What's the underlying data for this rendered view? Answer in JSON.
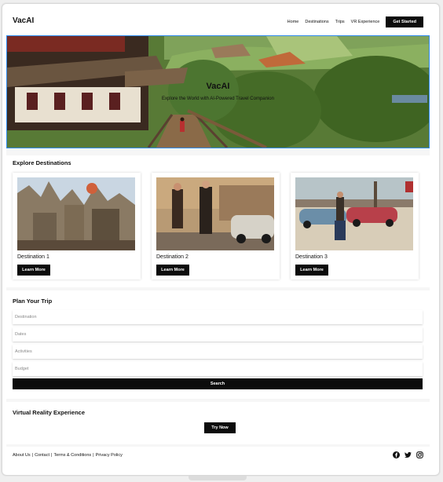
{
  "nav": {
    "brand": "VacAI",
    "links": [
      "Home",
      "Destinations",
      "Trips",
      "VR Experience"
    ],
    "cta": "Get Started"
  },
  "hero": {
    "title": "VacAI",
    "subtitle": "Explore the World with AI-Powered Travel Companion"
  },
  "destinations": {
    "heading": "Explore Destinations",
    "cards": [
      {
        "title": "Destination 1",
        "button": "Learn More",
        "image": "fantasy-city-balloons"
      },
      {
        "title": "Destination 2",
        "button": "Learn More",
        "image": "men-vintage-car-street"
      },
      {
        "title": "Destination 3",
        "button": "Learn More",
        "image": "beach-vintage-cars"
      }
    ]
  },
  "plan": {
    "heading": "Plan Your Trip",
    "fields": [
      {
        "placeholder": "Destination"
      },
      {
        "placeholder": "Dates"
      },
      {
        "placeholder": "Activities"
      },
      {
        "placeholder": "Budget"
      }
    ],
    "button": "Search"
  },
  "vr": {
    "heading": "Virtual Reality Experience",
    "button": "Try Now"
  },
  "footer": {
    "links": [
      "About Us",
      "Contact",
      "Terms & Conditions",
      "Privacy Policy"
    ],
    "separator": "|",
    "socials": [
      "facebook-icon",
      "twitter-icon",
      "instagram-icon"
    ]
  },
  "colors": {
    "accent_border": "#2f8cf0",
    "button_bg": "#0c0c0c",
    "button_text": "#ffffff"
  }
}
